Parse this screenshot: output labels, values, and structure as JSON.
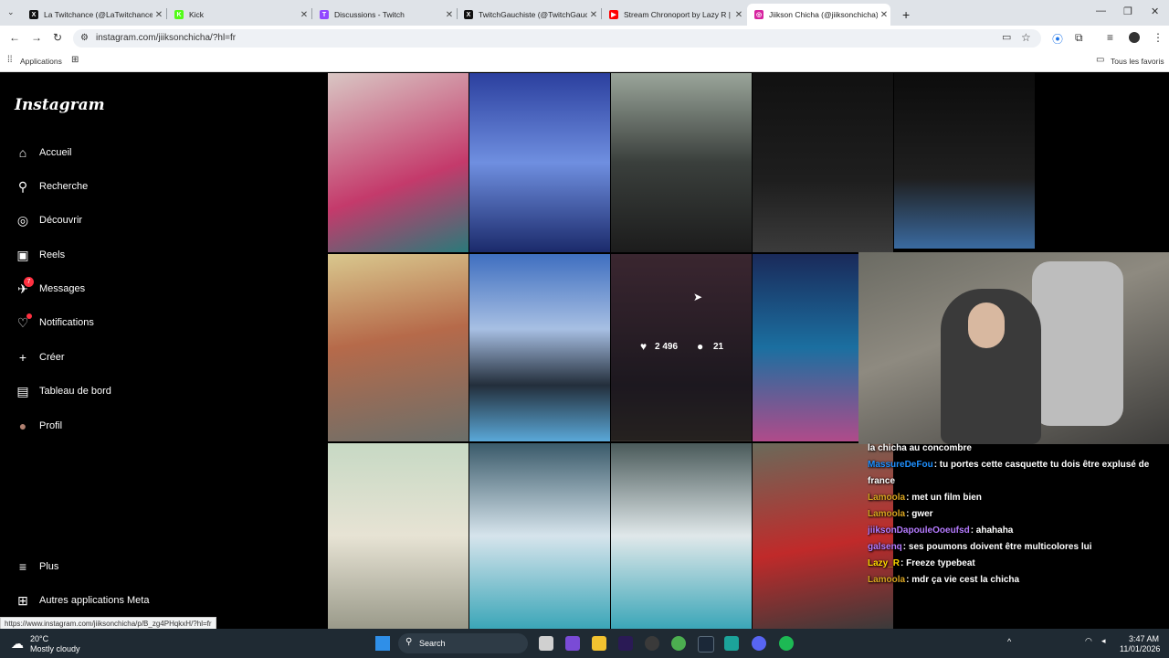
{
  "browser": {
    "tabs": [
      {
        "title": "La Twitchance (@LaTwitchance) /",
        "icon": "x-icon",
        "color": "#111111",
        "glyph": "X"
      },
      {
        "title": "Kick",
        "icon": "kick-icon",
        "color": "#53fc18",
        "glyph": "K"
      },
      {
        "title": "Discussions - Twitch",
        "icon": "twitch-icon",
        "color": "#9146ff",
        "glyph": "T"
      },
      {
        "title": "TwitchGauchiste (@TwitchGauc",
        "icon": "x-icon",
        "color": "#111111",
        "glyph": "X"
      },
      {
        "title": "Stream Chronoport by Lazy R |",
        "icon": "youtube-icon",
        "color": "#ff0000",
        "glyph": "▶"
      },
      {
        "title": "Jiikson Chicha (@jiiksonchicha)",
        "icon": "instagram-icon",
        "color": "#d6249f",
        "glyph": "◎"
      }
    ],
    "new_tab": "+",
    "url": "instagram.com/jiiksonchicha/?hl=fr",
    "bookmarks_apps": "Applications",
    "bookmarks_all": "Tous les favoris",
    "status_url": "https://www.instagram.com/jiiksonchicha/p/B_zg4PHqkxH/?hl=fr"
  },
  "instagram": {
    "logo": "Instagram",
    "nav": [
      {
        "label": "Accueil",
        "icon": "home-icon",
        "glyph": "⌂"
      },
      {
        "label": "Recherche",
        "icon": "search-icon",
        "glyph": "⚲"
      },
      {
        "label": "Découvrir",
        "icon": "compass-icon",
        "glyph": "◎"
      },
      {
        "label": "Reels",
        "icon": "reels-icon",
        "glyph": "▣"
      },
      {
        "label": "Messages",
        "icon": "messenger-icon",
        "glyph": "✈",
        "badge": "7"
      },
      {
        "label": "Notifications",
        "icon": "heart-icon",
        "glyph": "♡",
        "dot": true
      },
      {
        "label": "Créer",
        "icon": "plus-icon",
        "glyph": "+"
      },
      {
        "label": "Tableau de bord",
        "icon": "dashboard-icon",
        "glyph": "▤"
      },
      {
        "label": "Profil",
        "icon": "avatar",
        "glyph": "●"
      }
    ],
    "more": [
      {
        "label": "Plus",
        "icon": "menu-icon",
        "glyph": "≡"
      },
      {
        "label": "Autres applications Meta",
        "icon": "meta-apps-icon",
        "glyph": "⊞"
      }
    ],
    "hover_stats": {
      "likes": "2 496",
      "comments": "21"
    }
  },
  "chat": [
    {
      "user": "",
      "text": "la chicha au concombre",
      "color": "#ffffff"
    },
    {
      "user": "MassureDeFou",
      "text": ": tu portes cette casquette tu dois être explusé de france",
      "color": "#1e90ff"
    },
    {
      "user": "Lamoola",
      "text": ": met un film bien",
      "color": "#daa520"
    },
    {
      "user": "Lamoola",
      "text": ": gwer",
      "color": "#daa520"
    },
    {
      "user": "jiiksonDapouleOoeufsd",
      "text": ": ahahaha",
      "color": "#b57bff"
    },
    {
      "user": "galsenq",
      "text": ": ses poumons doivent être multicolores lui",
      "color": "#b57bff"
    },
    {
      "user": "Lazy_R",
      "text": ": Freeze typebeat",
      "color": "#ffd700"
    },
    {
      "user": "Lamoola",
      "text": ": mdr ça vie cest la chicha",
      "color": "#daa520"
    }
  ],
  "taskbar": {
    "temp": "20°C",
    "weather": "Mostly cloudy",
    "search": "Search",
    "time": "3:47 AM",
    "date": "11/01/2026"
  }
}
